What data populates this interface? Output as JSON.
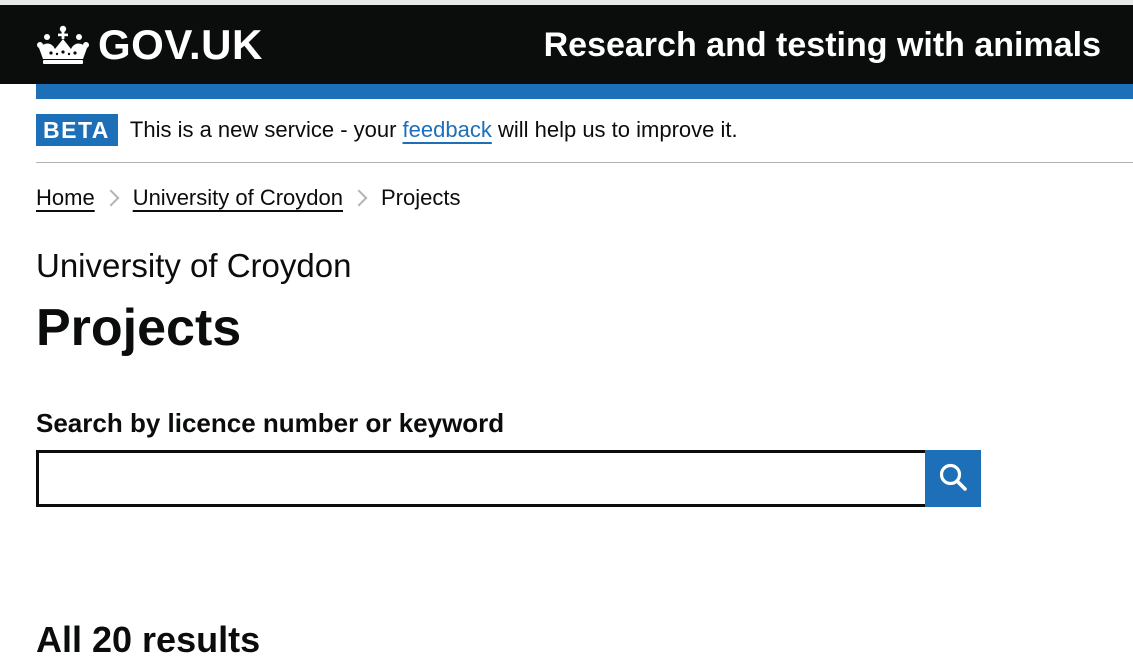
{
  "header": {
    "logo_text": "GOV.UK",
    "service_name": "Research and testing with animals",
    "logo_icon": "crown-icon"
  },
  "phase_banner": {
    "tag": "BETA",
    "text_before": "This is a new service - your ",
    "link_text": "feedback",
    "text_after": " will help us to improve it."
  },
  "breadcrumbs": {
    "items": [
      "Home",
      "University of Croydon",
      "Projects"
    ]
  },
  "page": {
    "caption": "University of Croydon",
    "title": "Projects"
  },
  "search": {
    "label": "Search by licence number or keyword",
    "value": "",
    "placeholder": "",
    "button_icon": "search-icon"
  },
  "results": {
    "heading": "All 20 results"
  },
  "colors": {
    "header_bg": "#0b0c0c",
    "brand_blue": "#1d70b8",
    "text": "#0b0c0c",
    "divider": "#b1b4b6"
  }
}
